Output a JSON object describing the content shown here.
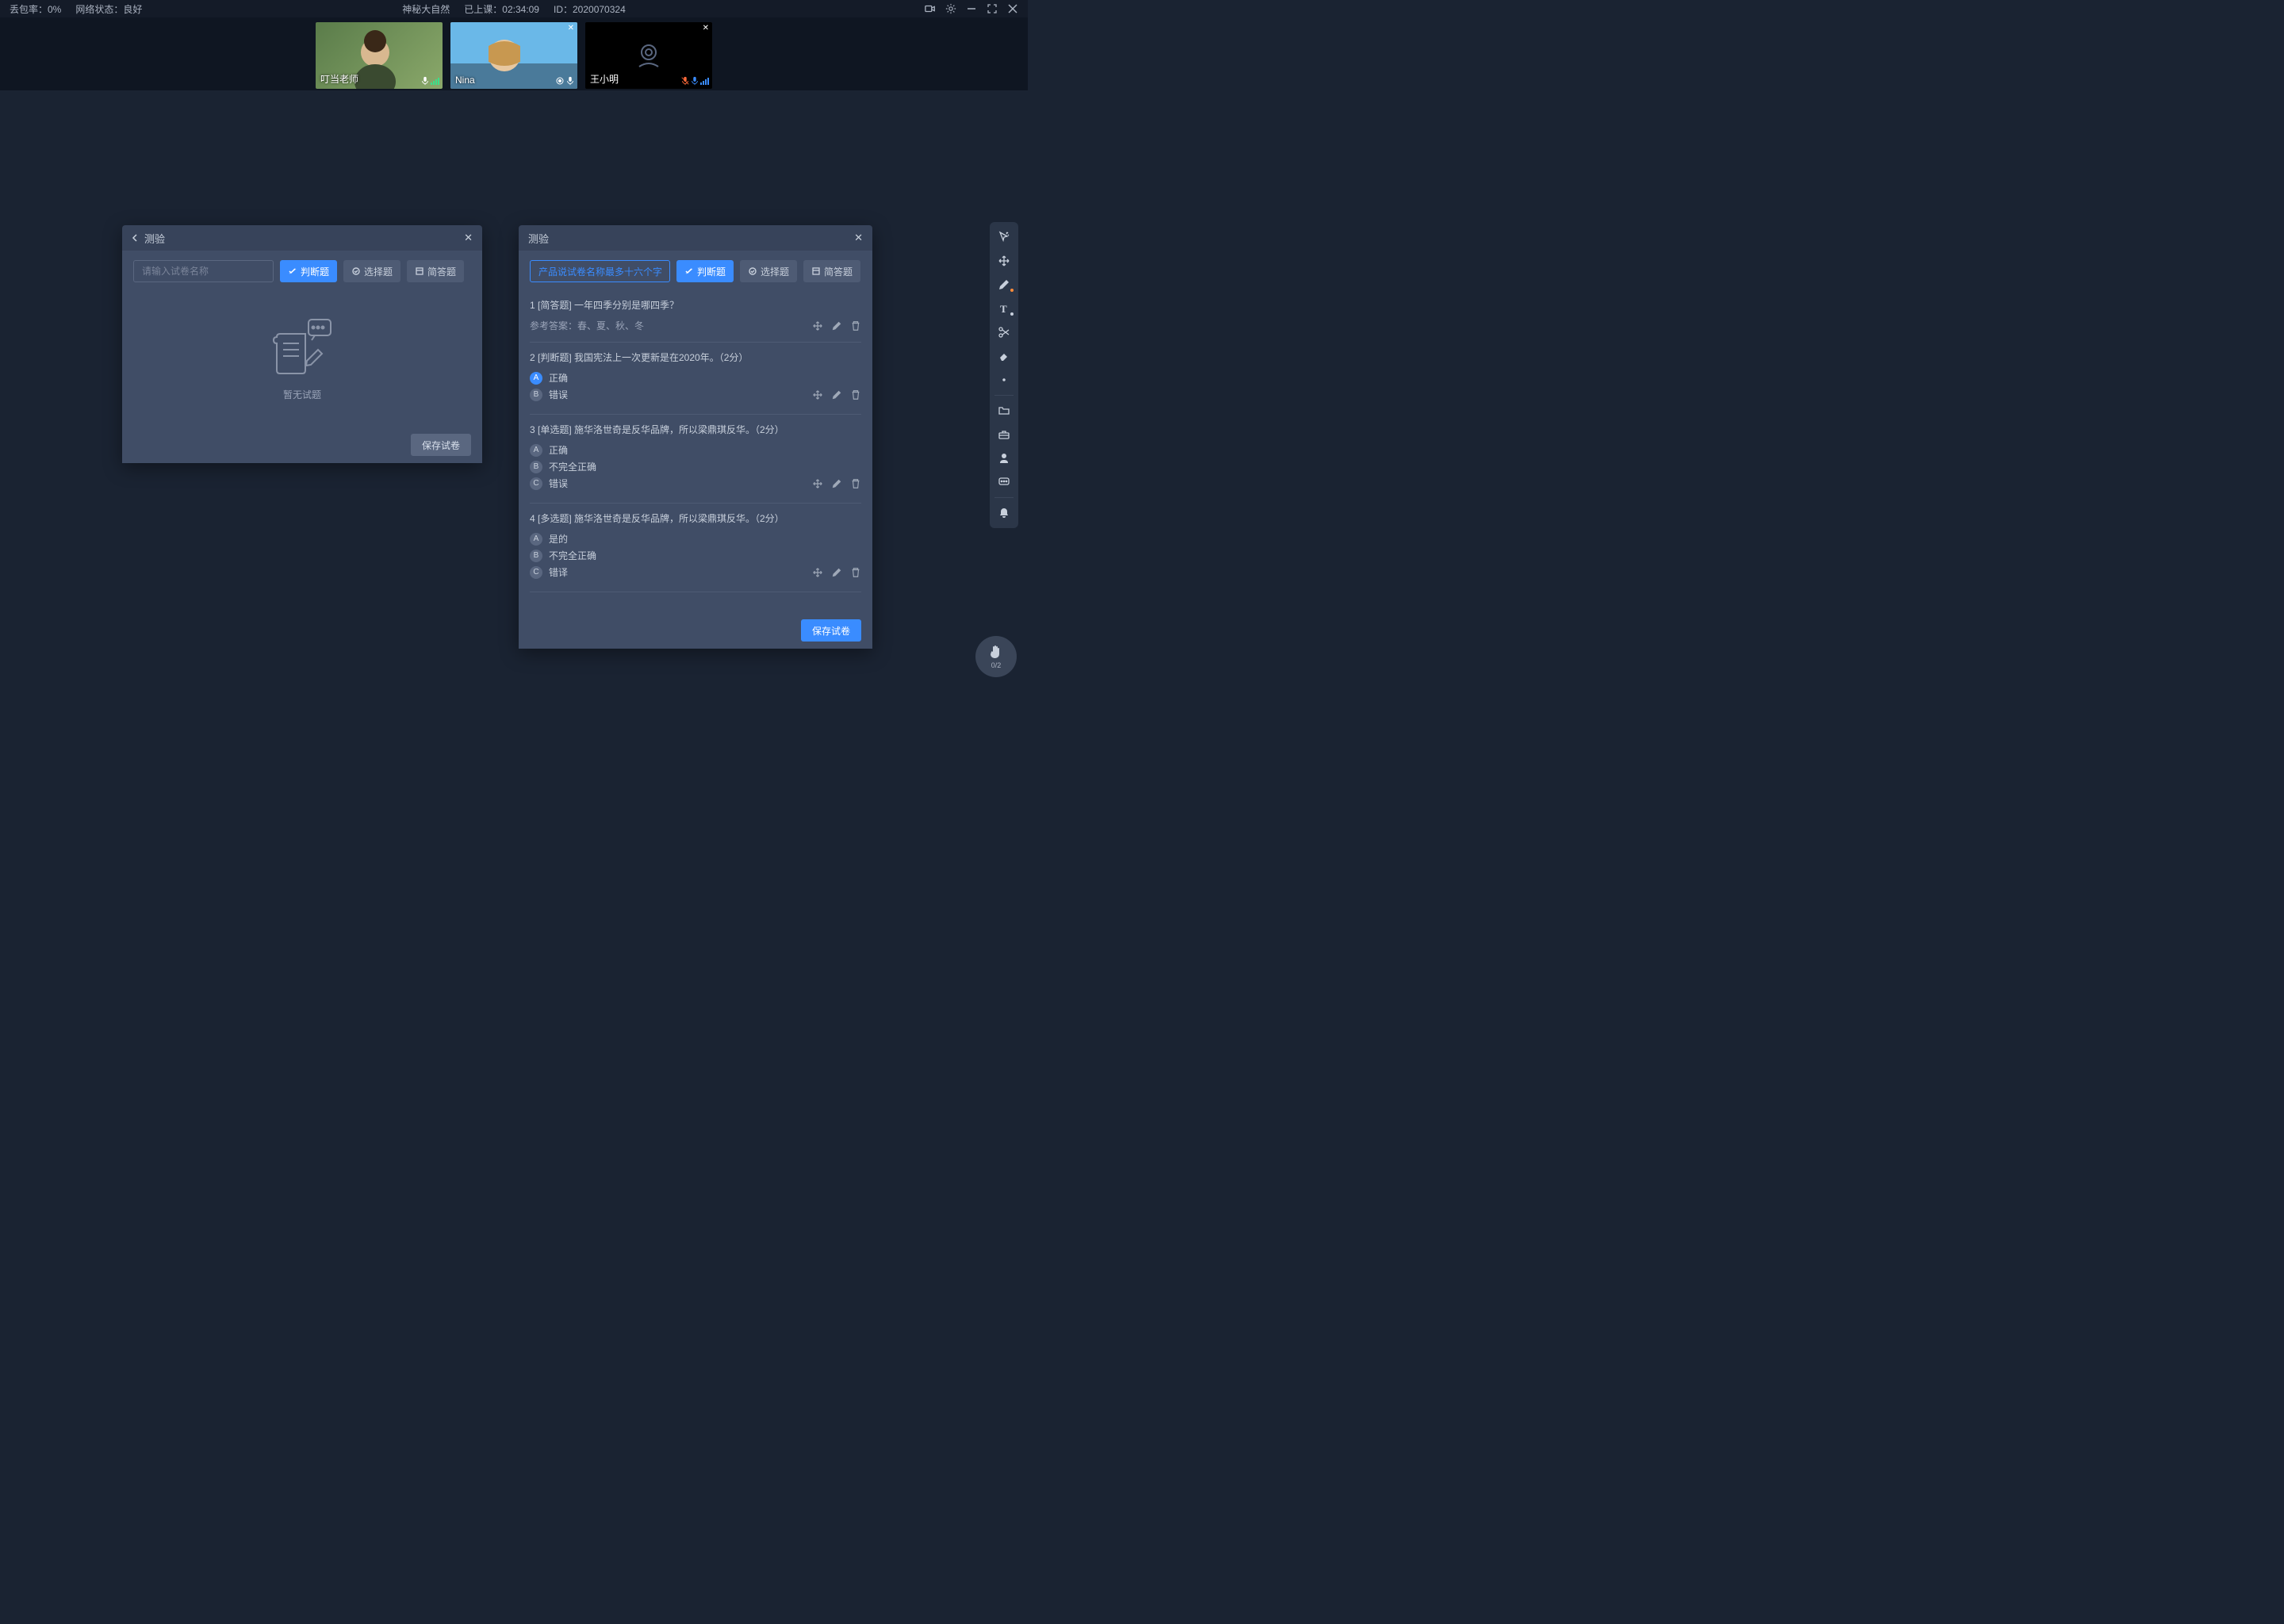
{
  "topbar": {
    "packet_loss_label": "丢包率：0%",
    "network_label": "网络状态：良好",
    "title": "神秘大自然",
    "elapsed_label": "已上课：",
    "elapsed_value": "02:34:09",
    "id_label": "ID：",
    "id_value": "2020070324"
  },
  "videos": [
    {
      "name": "叮当老师",
      "has_signal": true,
      "camera_off": false
    },
    {
      "name": "Nina",
      "has_signal": false,
      "camera_off": false,
      "closable": true
    },
    {
      "name": "王小明",
      "has_signal": true,
      "camera_off": true,
      "mic_muted": true,
      "closable": true
    }
  ],
  "left_panel": {
    "title": "测验",
    "input_placeholder": "请输入试卷名称",
    "chips": {
      "judge": "判断题",
      "choice": "选择题",
      "short": "简答题"
    },
    "empty_label": "暂无试题",
    "save_label": "保存试卷"
  },
  "right_panel": {
    "title": "测验",
    "input_value": "产品说试卷名称最多十六个字",
    "chips": {
      "judge": "判断题",
      "choice": "选择题",
      "short": "简答题"
    },
    "save_label": "保存试卷",
    "ref_answer_label": "参考答案：",
    "questions": [
      {
        "index": "1",
        "type": "[简答题]",
        "text": "一年四季分别是哪四季？",
        "ref_answer": "春、夏、秋、冬",
        "options": []
      },
      {
        "index": "2",
        "type": "[判断题]",
        "text": "我国宪法上一次更新是在2020年。（2分）",
        "options": [
          {
            "key": "A",
            "label": "正确",
            "selected": true
          },
          {
            "key": "B",
            "label": "错误"
          }
        ]
      },
      {
        "index": "3",
        "type": "[单选题]",
        "text": "施华洛世奇是反华品牌，所以梁鼎琪反华。（2分）",
        "options": [
          {
            "key": "A",
            "label": "正确"
          },
          {
            "key": "B",
            "label": "不完全正确"
          },
          {
            "key": "C",
            "label": "错误"
          }
        ]
      },
      {
        "index": "4",
        "type": "[多选题]",
        "text": "施华洛世奇是反华品牌，所以梁鼎琪反华。（2分）",
        "options": [
          {
            "key": "A",
            "label": "是的"
          },
          {
            "key": "B",
            "label": "不完全正确"
          },
          {
            "key": "C",
            "label": "错译"
          }
        ]
      }
    ]
  },
  "hand_fab": {
    "count": "0/2"
  },
  "icons": {
    "toolbar": [
      "pointer",
      "move",
      "pen",
      "text",
      "scissors",
      "eraser",
      "brightness",
      "folder",
      "toolbox",
      "person",
      "chat",
      "bell"
    ]
  }
}
